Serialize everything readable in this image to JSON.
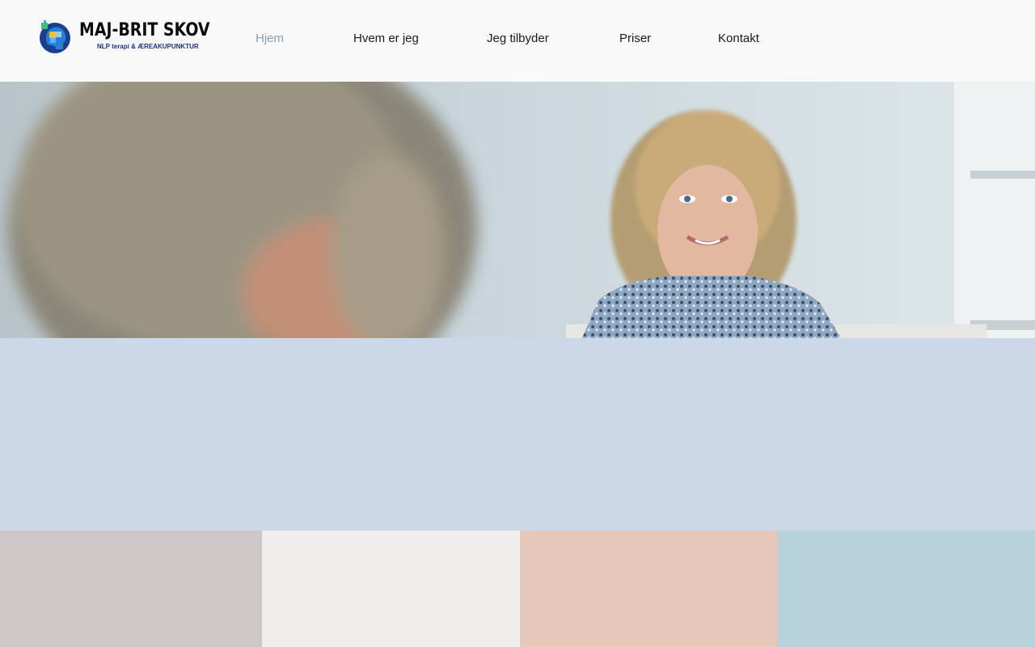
{
  "site": {
    "logo_title": "MAJ-BRIT SKOV",
    "logo_subtitle": "NLP terapi & ÆREAKUPUNKTUR"
  },
  "nav": {
    "items": [
      {
        "label": "Hjem",
        "active": true
      },
      {
        "label": "Hvem er jeg",
        "active": false
      },
      {
        "label": "Jeg tilbyder",
        "active": false
      },
      {
        "label": "Priser",
        "active": false
      },
      {
        "label": "Kontakt",
        "active": false
      }
    ]
  },
  "hero": {
    "image": "portrait-photo"
  },
  "colors": {
    "header_bg": "#f9f9f9",
    "nav_active": "#8b9bb0",
    "band_bg": "#cbd8e7",
    "tile_1": "#cdc7c7",
    "tile_2": "#efeeec",
    "tile_3": "#e5c8b8",
    "tile_4": "#b7d2db"
  }
}
